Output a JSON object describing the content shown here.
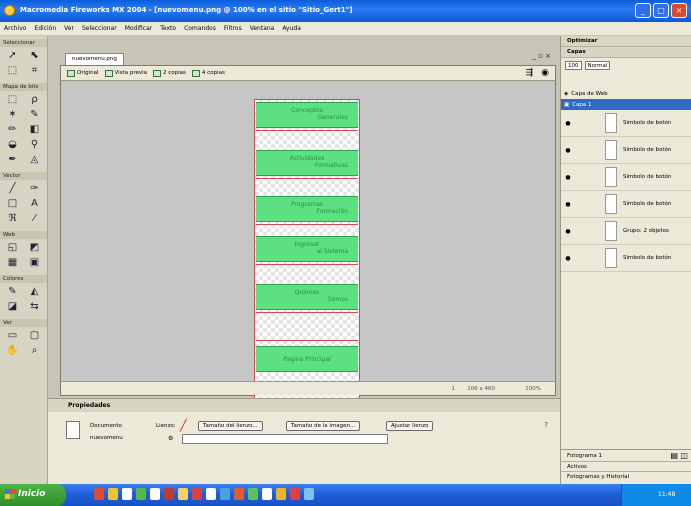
{
  "window": {
    "title": "Macromedia Fireworks MX 2004 - [nuevomenu.png @ 100% en el sitio \"Sitio_Gert1\"]",
    "controls": [
      "_",
      "□",
      "×"
    ]
  },
  "menubar": [
    "Archivo",
    "Edición",
    "Ver",
    "Seleccionar",
    "Modificar",
    "Texto",
    "Comandos",
    "Filtros",
    "Ventana",
    "Ayuda"
  ],
  "tools": {
    "sections": [
      "Seleccionar",
      "Mapa de bits",
      "Vector",
      "Web",
      "Colores",
      "Ver"
    ]
  },
  "document": {
    "tab": "nuevomenu.png",
    "window_controls": "_ ▫ ×",
    "view_tabs": [
      "Original",
      "Vista previa",
      "2 copias",
      "4 copias"
    ],
    "menu_buttons": [
      {
        "line1": "Conceptos",
        "line2": "Generales"
      },
      {
        "line1": "Actividades",
        "line2": "Formativas"
      },
      {
        "line1": "Programas",
        "line2": "Formación"
      },
      {
        "line1": "Ingresar",
        "line2": "al Sistema"
      },
      {
        "line1": "Quienes",
        "line2": "Somos"
      },
      {
        "line1": "Pagina Principal",
        "line2": ""
      }
    ],
    "status": {
      "frames": "1",
      "size": "106 x 460",
      "zoom": "100%"
    }
  },
  "properties": {
    "title": "Propiedades",
    "doc_label": "Documento",
    "doc_name": "nuevomenu",
    "canvas_label": "Lienzo:",
    "buttons": [
      "Tamaño del lienzo...",
      "Tamaño de la imagen...",
      "Ajustar lienzo"
    ]
  },
  "right_panel": {
    "optimize": "Optimizar",
    "layers": "Capas",
    "opacity": "100",
    "blend": "Normal",
    "web_layer": "Capa de Web",
    "layer1": "Capa 1",
    "objects": [
      "Símbolo de botón",
      "Símbolo de botón",
      "Símbolo de botón",
      "Símbolo de botón",
      "Grupo: 2 objetos",
      "Símbolo de botón"
    ],
    "frames": "Fotograma 1",
    "assets": "Activos",
    "history": "Fotogramas y Historial"
  },
  "taskbar": {
    "start": "Inicio",
    "clock": "11:48"
  }
}
